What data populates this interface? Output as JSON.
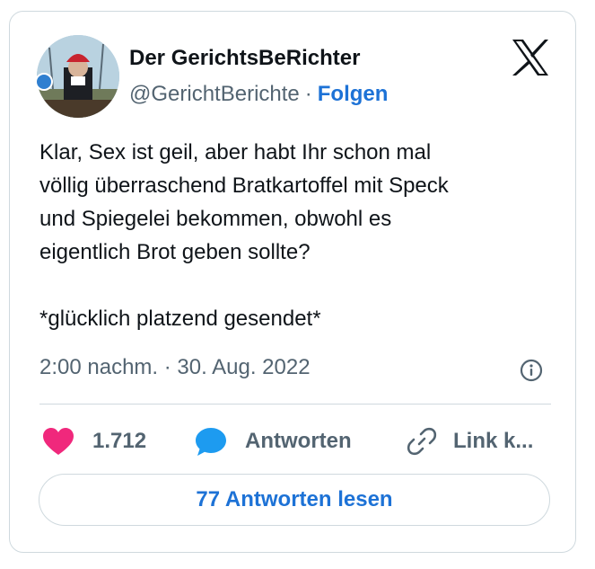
{
  "tweet": {
    "author_name": "Der GerichtsBeRichter",
    "handle": "@GerichtBerichte",
    "separator": "·",
    "follow_label": "Folgen",
    "text_lines": [
      "Klar, Sex ist geil, aber habt Ihr schon mal",
      "völlig überraschend Bratkartoffel mit Speck",
      "und Spiegelei bekommen, obwohl es",
      "eigentlich Brot geben sollte?"
    ],
    "text_footer": "*glücklich platzend gesendet*",
    "timestamp": "2:00 nachm. · 30. Aug. 2022"
  },
  "actions": {
    "like_count": "1.712",
    "reply_label": "Antworten",
    "link_label": "Link k..."
  },
  "read_replies_label": "77 Antworten lesen",
  "icons": {
    "brand": "x-logo-icon",
    "info": "info-icon",
    "like": "heart-icon",
    "reply": "speech-bubble-icon",
    "link": "link-icon"
  },
  "colors": {
    "accent_blue": "#1d72d6",
    "heart": "#f0287c",
    "reply_bubble": "#1d9bf0",
    "muted_text": "#536471",
    "border": "#cfd9de"
  }
}
